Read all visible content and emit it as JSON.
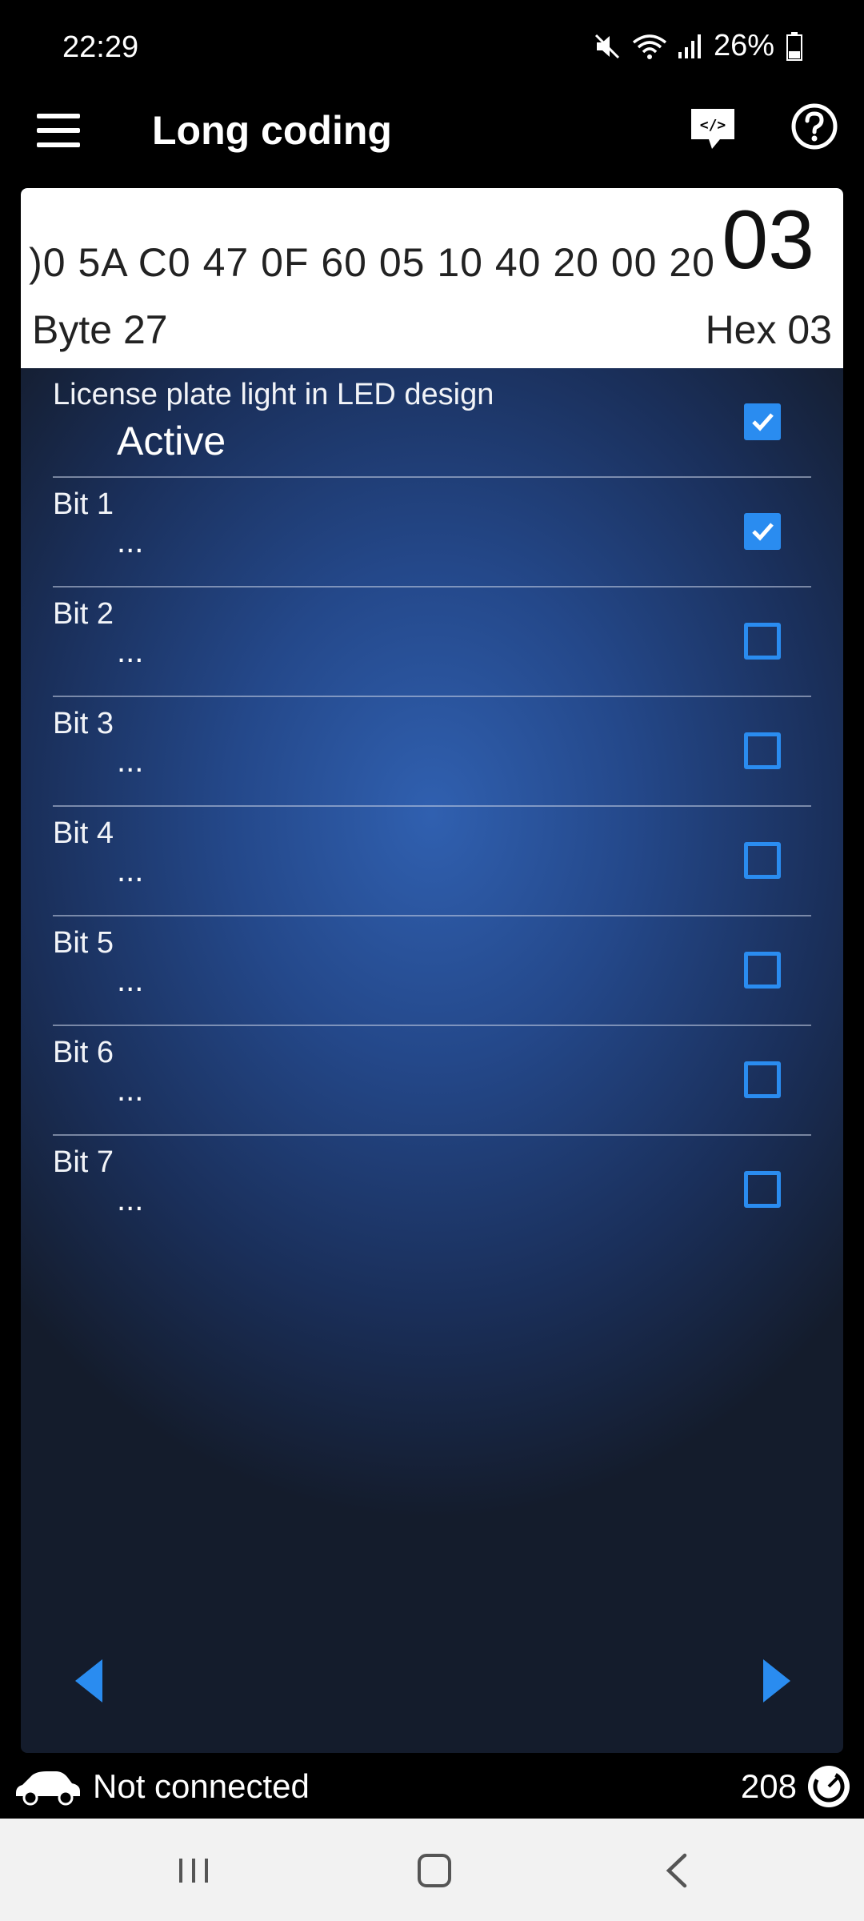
{
  "status_bar": {
    "time": "22:29",
    "battery": "26%",
    "icons": [
      "mute-icon",
      "wifi-icon",
      "signal-icon",
      "battery-icon"
    ]
  },
  "app_bar": {
    "title": "Long coding",
    "icons": [
      "menu-icon",
      "code-icon",
      "help-icon"
    ]
  },
  "coding_header": {
    "hex_stream": ")0 5A C0 47 0F 60 05 10 40 20 00 20",
    "current_hex": "03",
    "byte_label": "Byte 27",
    "hex_label": "Hex 03"
  },
  "bits": [
    {
      "title": "License plate light in LED design",
      "value": "Active",
      "checked": true
    },
    {
      "title": "Bit 1",
      "value": "...",
      "checked": true
    },
    {
      "title": "Bit 2",
      "value": "...",
      "checked": false
    },
    {
      "title": "Bit 3",
      "value": "...",
      "checked": false
    },
    {
      "title": "Bit 4",
      "value": "...",
      "checked": false
    },
    {
      "title": "Bit 5",
      "value": "...",
      "checked": false
    },
    {
      "title": "Bit 6",
      "value": "...",
      "checked": false
    },
    {
      "title": "Bit 7",
      "value": "...",
      "checked": false
    }
  ],
  "navigation": {
    "prev_icon": "arrow-left-icon",
    "next_icon": "arrow-right-icon"
  },
  "connection": {
    "status": "Not connected",
    "count": "208"
  },
  "colors": {
    "accent": "#2a8cf0",
    "panel_center": "#3060b0",
    "panel_edge": "#141c2c"
  }
}
